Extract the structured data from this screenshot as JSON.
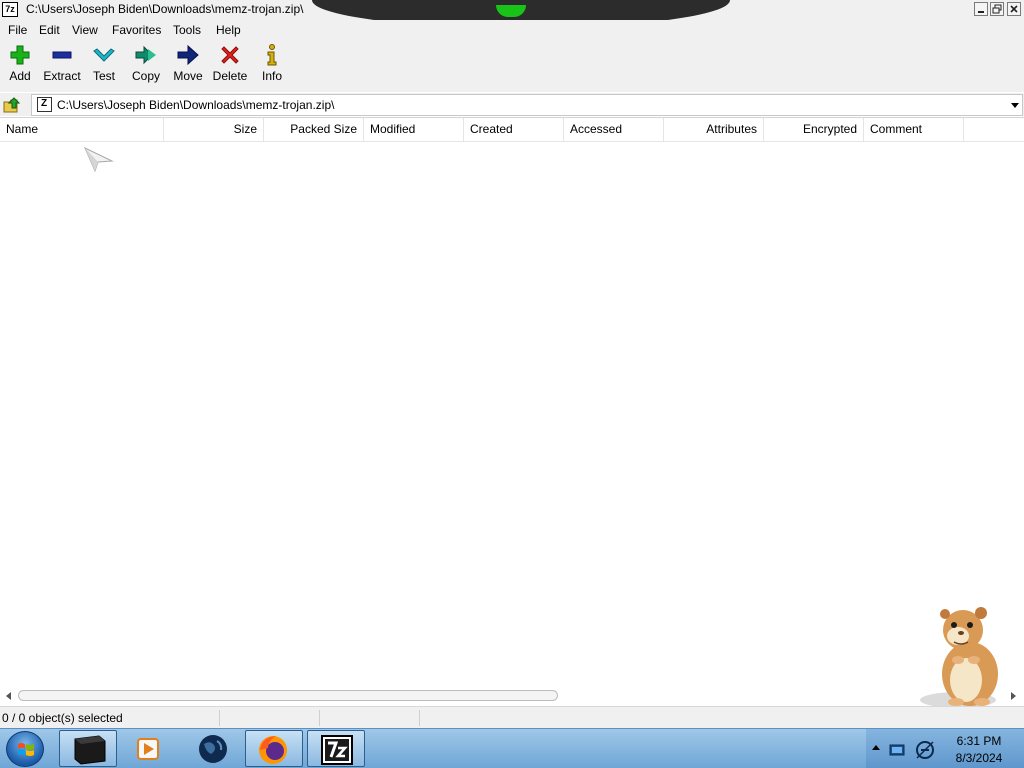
{
  "window": {
    "app_icon_text": "7z",
    "title": "C:\\Users\\Joseph Biden\\Downloads\\memz-trojan.zip\\"
  },
  "menu": [
    "File",
    "Edit",
    "View",
    "Favorites",
    "Tools",
    "Help"
  ],
  "toolbar": [
    {
      "label": "Add",
      "icon": "plus-icon",
      "color": "#19b219"
    },
    {
      "label": "Extract",
      "icon": "minus-icon",
      "color": "#1c2f9e"
    },
    {
      "label": "Test",
      "icon": "check-icon",
      "color": "#1eb5c8"
    },
    {
      "label": "Copy",
      "icon": "double-arrow-icon",
      "color": "#0f8a6a"
    },
    {
      "label": "Move",
      "icon": "arrow-right-icon",
      "color": "#10257a"
    },
    {
      "label": "Delete",
      "icon": "x-icon",
      "color": "#e0231b"
    },
    {
      "label": "Info",
      "icon": "info-icon",
      "color": "#d6b10c"
    }
  ],
  "address": {
    "path": "C:\\Users\\Joseph Biden\\Downloads\\memz-trojan.zip\\"
  },
  "columns": [
    "Name",
    "Size",
    "Packed Size",
    "Modified",
    "Created",
    "Accessed",
    "Attributes",
    "Encrypted",
    "Comment"
  ],
  "rows": [],
  "status": {
    "selection": "0 / 0 object(s) selected"
  },
  "taskbar": {
    "items": [
      "terminal-icon",
      "media-player-icon",
      "earth-icon",
      "firefox-icon",
      "7zip-icon"
    ],
    "time": "6:31 PM",
    "date": "8/3/2024"
  }
}
